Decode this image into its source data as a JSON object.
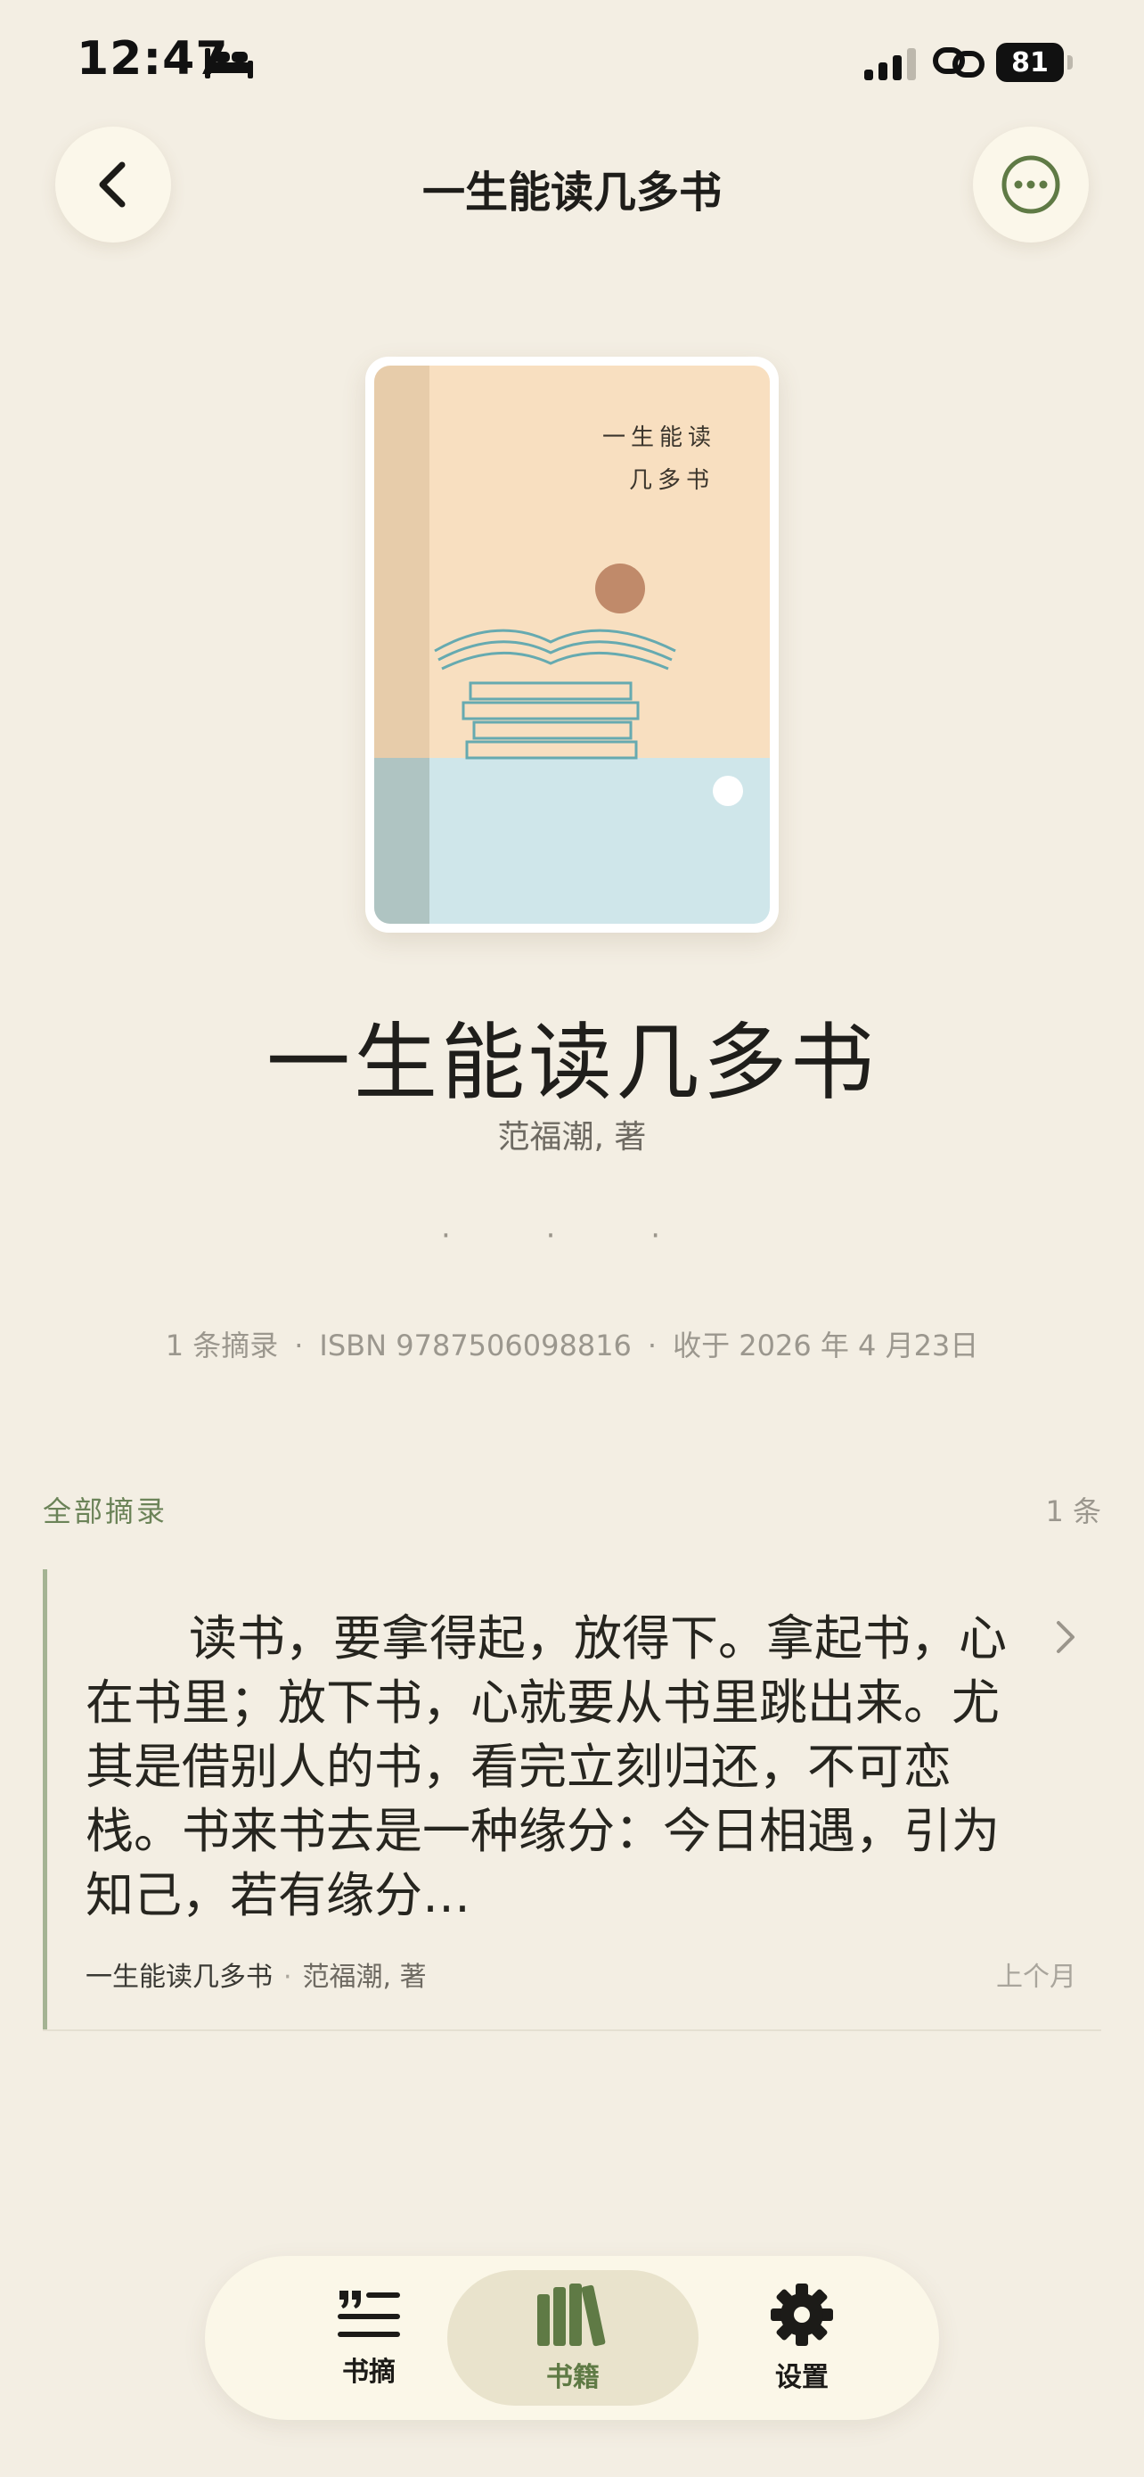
{
  "status_bar": {
    "time": "12:47",
    "battery": "81"
  },
  "header": {
    "title": "一生能读几多书"
  },
  "cover": {
    "title_line1": "一生能读",
    "title_line2": "几多书"
  },
  "book": {
    "title": "一生能读几多书",
    "author": "范福潮, 著",
    "dots": "· · ·",
    "excerpt_count": "1 条摘录",
    "isbn": "ISBN 9787506098816",
    "added": "收于 2026 年 4 月23日",
    "separator": "·"
  },
  "section": {
    "label": "全部摘录",
    "count": "1 条"
  },
  "excerpts": [
    {
      "text": "读书，要拿得起，放得下。拿起书，心在书里；放下书，心就要从书里跳出来。尤其是借别人的书，看完立刻归还，不可恋栈。书来书去是一种缘分：今日相遇，引为知己，若有缘分…",
      "book": "一生能读几多书",
      "separator": "·",
      "author": "范福潮, 著",
      "date": "上个月"
    }
  ],
  "tabbar": {
    "items": [
      {
        "label": "书摘",
        "icon": "quote-list-icon"
      },
      {
        "label": "书籍",
        "icon": "books-icon",
        "active": true
      },
      {
        "label": "设置",
        "icon": "gear-icon"
      }
    ]
  },
  "colors": {
    "background": "#f3eee3",
    "accent": "#6b8358",
    "active_tab": "#e9e3cc"
  }
}
